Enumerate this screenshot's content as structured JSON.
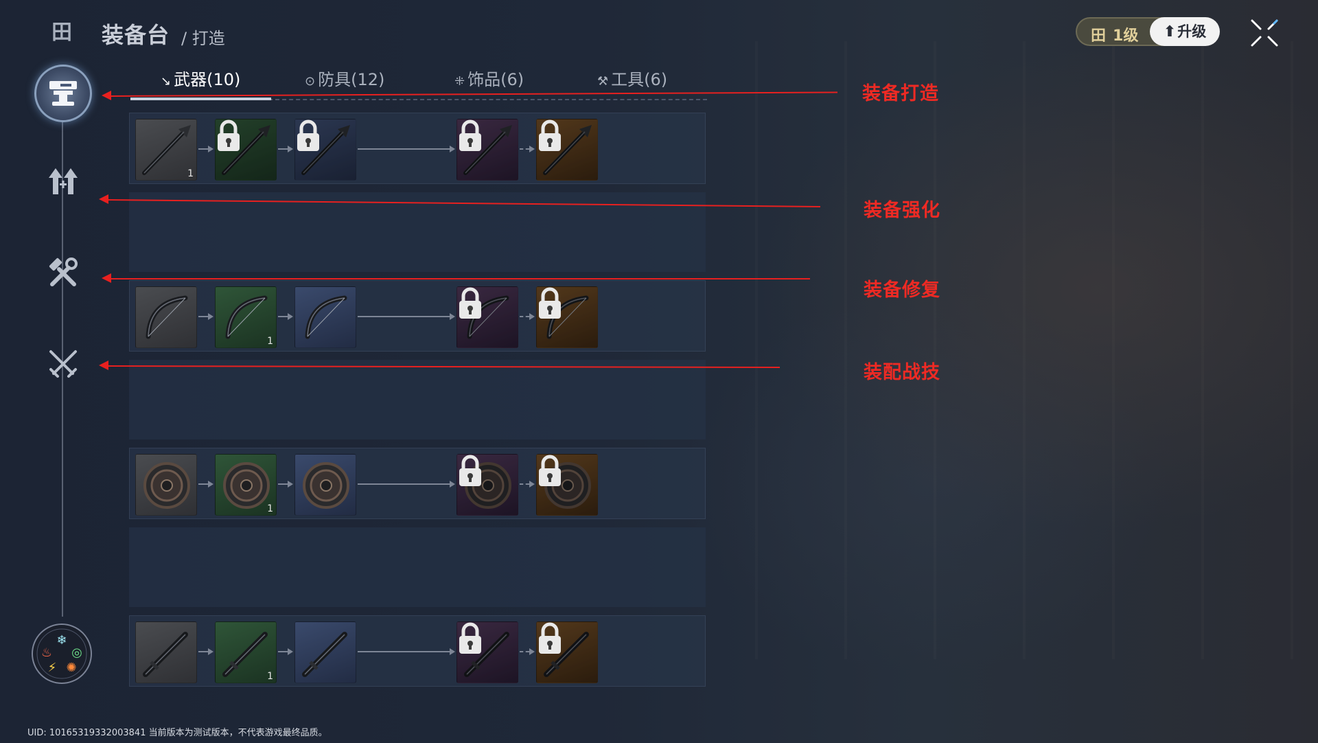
{
  "header": {
    "app_icon": "crafting-bench-icon",
    "title": "装备台",
    "subtitle": "/ 打造",
    "level_text": "1级",
    "upgrade_label": "升级",
    "close_icon": "close-icon"
  },
  "tabs": [
    {
      "icon": "sword-icon",
      "label": "武器(10)",
      "active": true
    },
    {
      "icon": "shield-icon",
      "label": "防具(12)",
      "active": false
    },
    {
      "icon": "accessory-icon",
      "label": "饰品(6)",
      "active": false
    },
    {
      "icon": "pickaxe-icon",
      "label": "工具(6)",
      "active": false
    }
  ],
  "sidebar": [
    {
      "name": "anvil-icon",
      "active": true
    },
    {
      "name": "upgrade-arrows-icon",
      "active": false
    },
    {
      "name": "repair-tools-icon",
      "active": false
    },
    {
      "name": "crossed-swords-icon",
      "active": false
    }
  ],
  "element_wheel_icon": "element-wheel-icon",
  "rows": [
    {
      "item": "spear",
      "slots": [
        {
          "quality": "gray",
          "locked": false,
          "count": "1"
        },
        {
          "quality": "green",
          "locked": true,
          "count": ""
        },
        {
          "quality": "blue",
          "locked": true,
          "count": ""
        },
        {
          "quality": "purple",
          "locked": true,
          "count": ""
        },
        {
          "quality": "orange",
          "locked": true,
          "count": ""
        }
      ]
    },
    {
      "item": "bow",
      "slots": [
        {
          "quality": "gray",
          "locked": false,
          "count": ""
        },
        {
          "quality": "green",
          "locked": false,
          "count": "1"
        },
        {
          "quality": "blue",
          "locked": false,
          "count": ""
        },
        {
          "quality": "purple",
          "locked": true,
          "count": ""
        },
        {
          "quality": "orange",
          "locked": true,
          "count": ""
        }
      ]
    },
    {
      "item": "shield",
      "slots": [
        {
          "quality": "gray",
          "locked": false,
          "count": ""
        },
        {
          "quality": "green",
          "locked": false,
          "count": "1"
        },
        {
          "quality": "blue",
          "locked": false,
          "count": ""
        },
        {
          "quality": "purple",
          "locked": true,
          "count": ""
        },
        {
          "quality": "orange",
          "locked": true,
          "count": ""
        }
      ]
    },
    {
      "item": "sword",
      "slots": [
        {
          "quality": "gray",
          "locked": false,
          "count": ""
        },
        {
          "quality": "green",
          "locked": false,
          "count": "1"
        },
        {
          "quality": "blue",
          "locked": false,
          "count": ""
        },
        {
          "quality": "purple",
          "locked": true,
          "count": ""
        },
        {
          "quality": "orange",
          "locked": true,
          "count": ""
        }
      ]
    }
  ],
  "annotations": [
    "装备打造",
    "装备强化",
    "装备修复",
    "装配战技"
  ],
  "footer": {
    "uid_text": "UID: 10165319332003841 当前版本为测试版本，不代表游戏最终品质。"
  },
  "colors": {
    "annotation_red": "#e8201f",
    "quality_gray": "#3c3e42",
    "quality_green": "#26452d",
    "quality_blue": "#2e3a58",
    "quality_purple": "#3b2844",
    "quality_orange": "#56391b"
  }
}
